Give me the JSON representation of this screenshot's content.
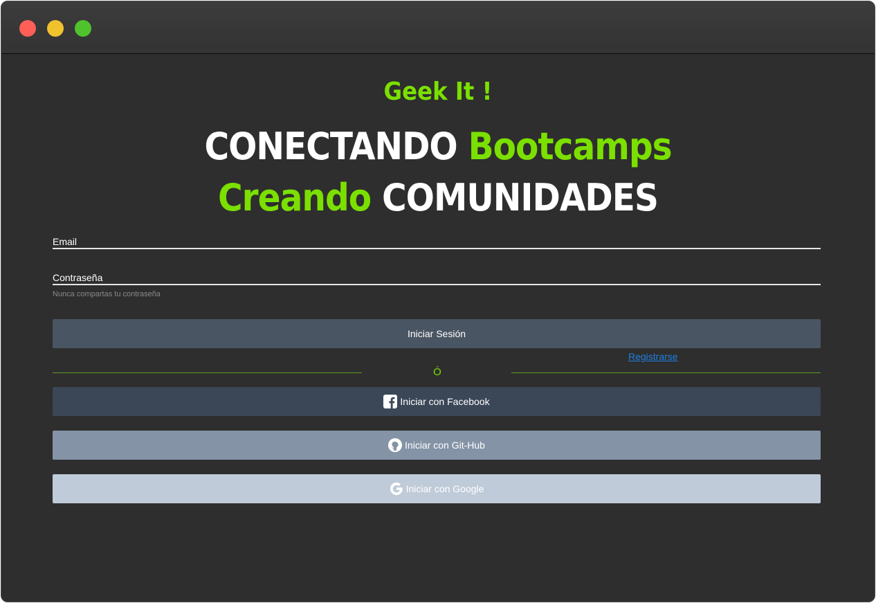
{
  "colors": {
    "accent": "#7be000",
    "background": "#2e2e2e",
    "link": "#1e7fe0"
  },
  "window_controls": [
    "close",
    "minimize",
    "zoom"
  ],
  "brand": "Geek It !",
  "headline": {
    "line1_white": "CONECTANDO",
    "line1_accent": "Bootcamps",
    "line2_accent": "Creando",
    "line2_white": "COMUNIDADES"
  },
  "form": {
    "email_label": "Email",
    "password_label": "Contraseña",
    "password_help": "Nunca compartas tu contraseña",
    "login_button": "Iniciar Sesión",
    "register_link": "Registrarse",
    "divider_text": "Ó"
  },
  "social": {
    "facebook": {
      "label": "Iniciar con Facebook",
      "icon": "facebook-icon"
    },
    "github": {
      "label": "Iniciar con Git-Hub",
      "icon": "github-icon"
    },
    "google": {
      "label": "Iniciar con Google",
      "icon": "google-icon"
    }
  }
}
